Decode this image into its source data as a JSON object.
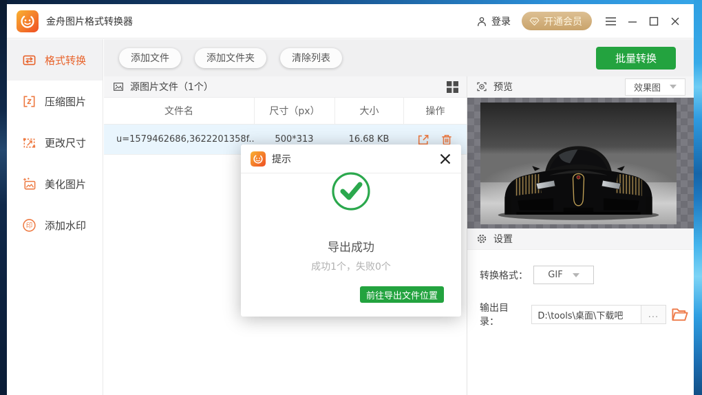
{
  "app": {
    "title": "金舟图片格式转换器"
  },
  "titlebar": {
    "login": "登录",
    "vip": "开通会员"
  },
  "sidebar": {
    "items": [
      {
        "label": "格式转换"
      },
      {
        "label": "压缩图片"
      },
      {
        "label": "更改尺寸"
      },
      {
        "label": "美化图片"
      },
      {
        "label": "添加水印"
      }
    ]
  },
  "toolbar": {
    "add_file": "添加文件",
    "add_folder": "添加文件夹",
    "clear_list": "清除列表",
    "batch_convert": "批量转换"
  },
  "file_panel": {
    "title": "源图片文件（1个）",
    "columns": [
      "文件名",
      "尺寸（px）",
      "大小",
      "操作"
    ],
    "rows": [
      {
        "name": "u=1579462686,3622201358f...",
        "dimensions": "500*313",
        "size": "16.68 KB"
      }
    ]
  },
  "preview": {
    "title": "预览",
    "mode": "效果图"
  },
  "settings": {
    "title": "设置",
    "format_label": "转换格式：",
    "format_value": "GIF",
    "output_label": "输出目录：",
    "output_path": "D:\\tools\\桌面\\下载吧",
    "more": "..."
  },
  "dialog": {
    "title": "提示",
    "message": "导出成功",
    "detail": "成功1个，失败0个",
    "action": "前往导出文件位置"
  },
  "watermark_glyph": "印",
  "colors": {
    "accent_orange": "#ed7035",
    "green": "#23a33f",
    "vip_gold": "#cfa877",
    "selected_row": "#e9f5fd"
  }
}
